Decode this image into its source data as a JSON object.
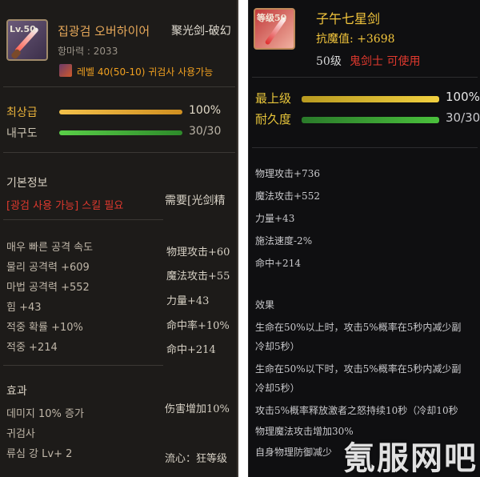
{
  "left": {
    "level_badge": "Lv.50",
    "item_name": "집광검 오버하이어",
    "item_name_cn": "聚光剑-破幻",
    "magic_resist": "항마력 : 2033",
    "requirement": "레벨 40(50-10) 귀검사 사용가능",
    "rarity_label": "최상급",
    "rarity_value": "100%",
    "durability_label": "내구도",
    "durability_value": "30/30",
    "rarity_fill": 1.0,
    "durability_fill": 1.0,
    "basic_info_header": "기본정보",
    "skill_required": "[광검 사용 가능] 스킬 필요",
    "skill_required_cn": "需要[光剑精",
    "stats_ko": [
      "매우 빠른 공격 속도",
      "물리 공격력 +609",
      "마법 공격력 +552",
      "힘 +43",
      "적중 확률 +10%",
      "적중 +214"
    ],
    "stats_cn": [
      "物理攻击+60",
      "魔法攻击+55",
      "力量+43",
      "命中率+10%",
      "命中+214"
    ],
    "effect_header": "효과",
    "effects_ko": [
      "데미지 10% 증가",
      "귀검사",
      "류심 강 Lv+ 2"
    ],
    "effects_cn": [
      "伤害增加10%",
      "流心：狂等级"
    ],
    "colors": {
      "gold": "#e9b23a",
      "green": "#43b53a",
      "red": "#e0392e",
      "orange_text": "#f0a020"
    }
  },
  "right": {
    "level_badge": "等级50",
    "item_name": "子午七星剑",
    "magic_resist": "抗魔值: +3698",
    "level_req": "50级",
    "class_req": "鬼剑士 可使用",
    "rarity_label": "最上级",
    "rarity_value": "100%",
    "durability_label": "耐久度",
    "durability_value": "30/30",
    "rarity_fill": 1.0,
    "durability_fill": 1.0,
    "stats": [
      "物理攻击+736",
      "魔法攻击+552",
      "力量+43",
      "施法速度-2%",
      "命中+214"
    ],
    "effect_header": "效果",
    "effects": [
      "生命在50%以上时，攻击5%概率在5秒内减少副",
      "冷却5秒）",
      "生命在50%以下时，攻击5%概率在5秒内减少副",
      "冷却5秒）",
      "攻击5%概率释放激者之怒持续10秒（冷却10秒",
      "物理魔法攻击增加30%",
      "自身物理防御减少"
    ],
    "watermark": "氪服网吧",
    "colors": {
      "gold": "#e7c53a",
      "green": "#3fb53b",
      "red": "#e0392e",
      "text_yellow": "#f2c53c"
    }
  }
}
